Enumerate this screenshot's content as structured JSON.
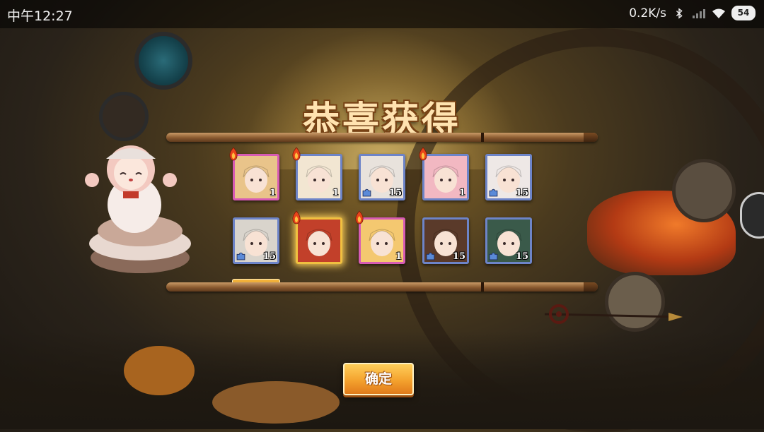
{
  "status_bar": {
    "time": "中午12:27",
    "speed": "0.2K/s",
    "battery": "54"
  },
  "dialog": {
    "title": "恭喜获得",
    "confirm_label": "确定"
  },
  "rewards": [
    {
      "count": "1",
      "rarity": "pink",
      "new": true,
      "fragment": false
    },
    {
      "count": "1",
      "rarity": "blue",
      "new": true,
      "fragment": false
    },
    {
      "count": "15",
      "rarity": "blue",
      "new": false,
      "fragment": true
    },
    {
      "count": "1",
      "rarity": "blue",
      "new": true,
      "fragment": false
    },
    {
      "count": "15",
      "rarity": "blue",
      "new": false,
      "fragment": true
    },
    {
      "count": "15",
      "rarity": "blue",
      "new": false,
      "fragment": true
    },
    {
      "count": "",
      "rarity": "gold",
      "new": true,
      "fragment": false
    },
    {
      "count": "1",
      "rarity": "pink",
      "new": true,
      "fragment": false
    },
    {
      "count": "15",
      "rarity": "blue",
      "new": false,
      "fragment": true
    },
    {
      "count": "15",
      "rarity": "blue",
      "new": false,
      "fragment": true
    }
  ],
  "colors": {
    "card_blue": "#6d84c8",
    "card_pink": "#d75bb4",
    "card_gold": "#f0c040",
    "button": "#f4a22e"
  },
  "icons": {
    "flame": "flame-icon",
    "fragment": "puzzle-piece-icon",
    "wifi": "wifi-icon",
    "bluetooth": "bluetooth-icon",
    "signal": "signal-icon"
  }
}
